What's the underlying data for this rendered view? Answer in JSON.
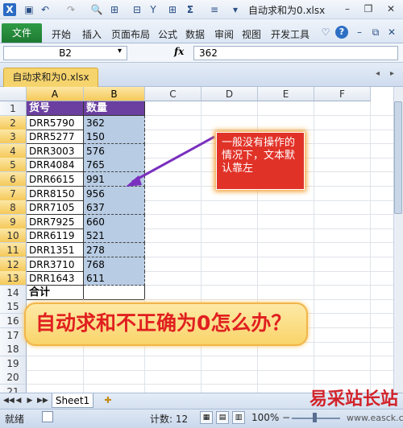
{
  "app": {
    "title": "自动求和为0.xlsx",
    "quick_access": [
      "save-icon",
      "undo-icon",
      "redo-icon",
      "print-preview-icon",
      "format-icon",
      "quick-icon",
      "filter-icon",
      "border-icon",
      "sum-icon",
      "align-icon",
      "customize-icon"
    ]
  },
  "window_controls": {
    "minimize": "–",
    "restore": "❐",
    "close": "✕"
  },
  "ribbon": {
    "file_tab": "文件",
    "tabs": [
      "开始",
      "插入",
      "页面布局",
      "公式",
      "数据",
      "审阅",
      "视图",
      "开发工具"
    ],
    "right_icons": [
      "♡",
      "?",
      "–",
      "⧉",
      "✕"
    ]
  },
  "formula_bar": {
    "name_box": "B2",
    "fx": "fx",
    "value": "362"
  },
  "document_tab": "自动求和为0.xlsx",
  "columns": [
    "A",
    "B",
    "C",
    "D",
    "E",
    "F"
  ],
  "rows": [
    "1",
    "2",
    "3",
    "4",
    "5",
    "6",
    "7",
    "8",
    "9",
    "10",
    "11",
    "12",
    "13",
    "14",
    "15",
    "16",
    "17",
    "18",
    "19",
    "20",
    "21"
  ],
  "table": {
    "headers": [
      "货号",
      "数量"
    ],
    "data": [
      [
        "DRR5790",
        "362"
      ],
      [
        "DRR5277",
        "150"
      ],
      [
        "DRR3003",
        "576"
      ],
      [
        "DRR4084",
        "765"
      ],
      [
        "DRR6615",
        "991"
      ],
      [
        "DRR8150",
        "956"
      ],
      [
        "DRR7105",
        "637"
      ],
      [
        "DRR7925",
        "660"
      ],
      [
        "DRR6119",
        "521"
      ],
      [
        "DRR1351",
        "278"
      ],
      [
        "DRR3710",
        "768"
      ],
      [
        "DRR1643",
        "611"
      ]
    ],
    "total_label": "合计"
  },
  "callout": {
    "text": "一般没有操作的情况下，文本默认靠左"
  },
  "banner": {
    "text": "自动求和不正确为0怎么办？"
  },
  "sheet_tabs": {
    "nav": [
      "◀◀",
      "◀",
      "▶",
      "▶▶"
    ],
    "active": "Sheet1"
  },
  "status_bar": {
    "ready": "就绪",
    "count_label": "计数: 12",
    "zoom": "100%",
    "zoom_minus": "−"
  },
  "watermark": {
    "logo": "易采站长站",
    "url": "www.easck.com"
  },
  "colors": {
    "header_fill": "#6b3fa0",
    "selection_fill": "#b8cce4",
    "callout_fill": "#e13228",
    "banner_text": "#e02020",
    "file_tab": "#2f9b45"
  }
}
